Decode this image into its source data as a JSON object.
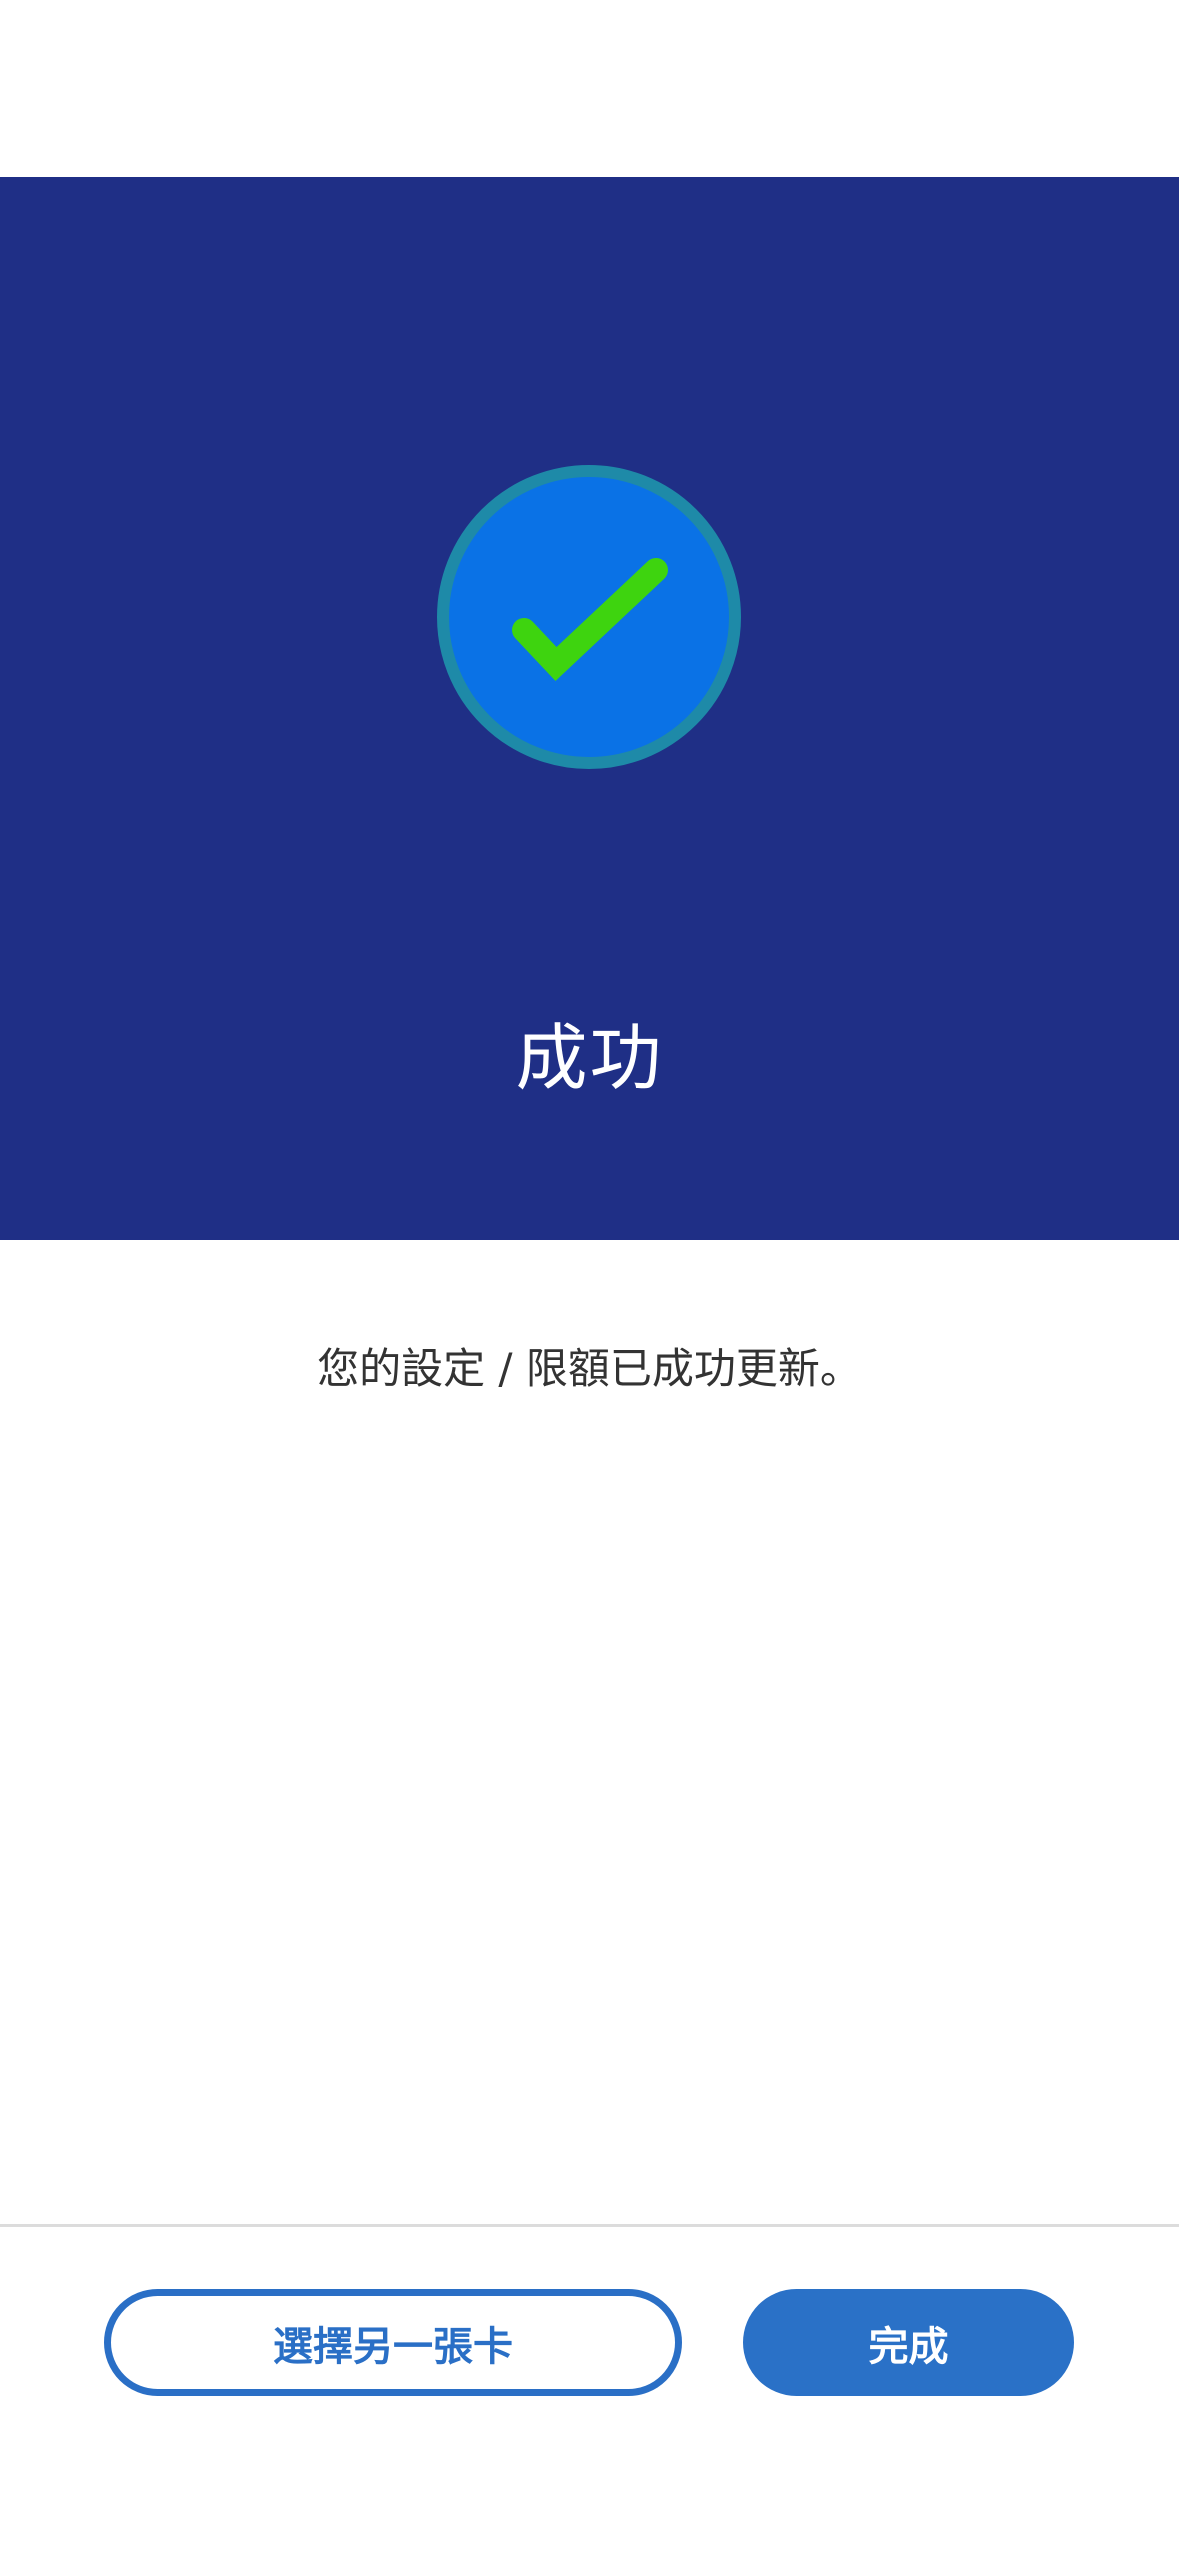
{
  "hero": {
    "title": "成功",
    "background_color": "#1f2f86",
    "icon": {
      "name": "checkmark-circle-icon",
      "circle_fill": "#0a72e6",
      "ring_color": "#1e8aa8",
      "check_color": "#3ed40f"
    }
  },
  "message": "您的設定 / 限額已成功更新。",
  "actions": {
    "choose_another_card_label": "選擇另一張卡",
    "done_label": "完成",
    "accent_color": "#2a71c7"
  }
}
